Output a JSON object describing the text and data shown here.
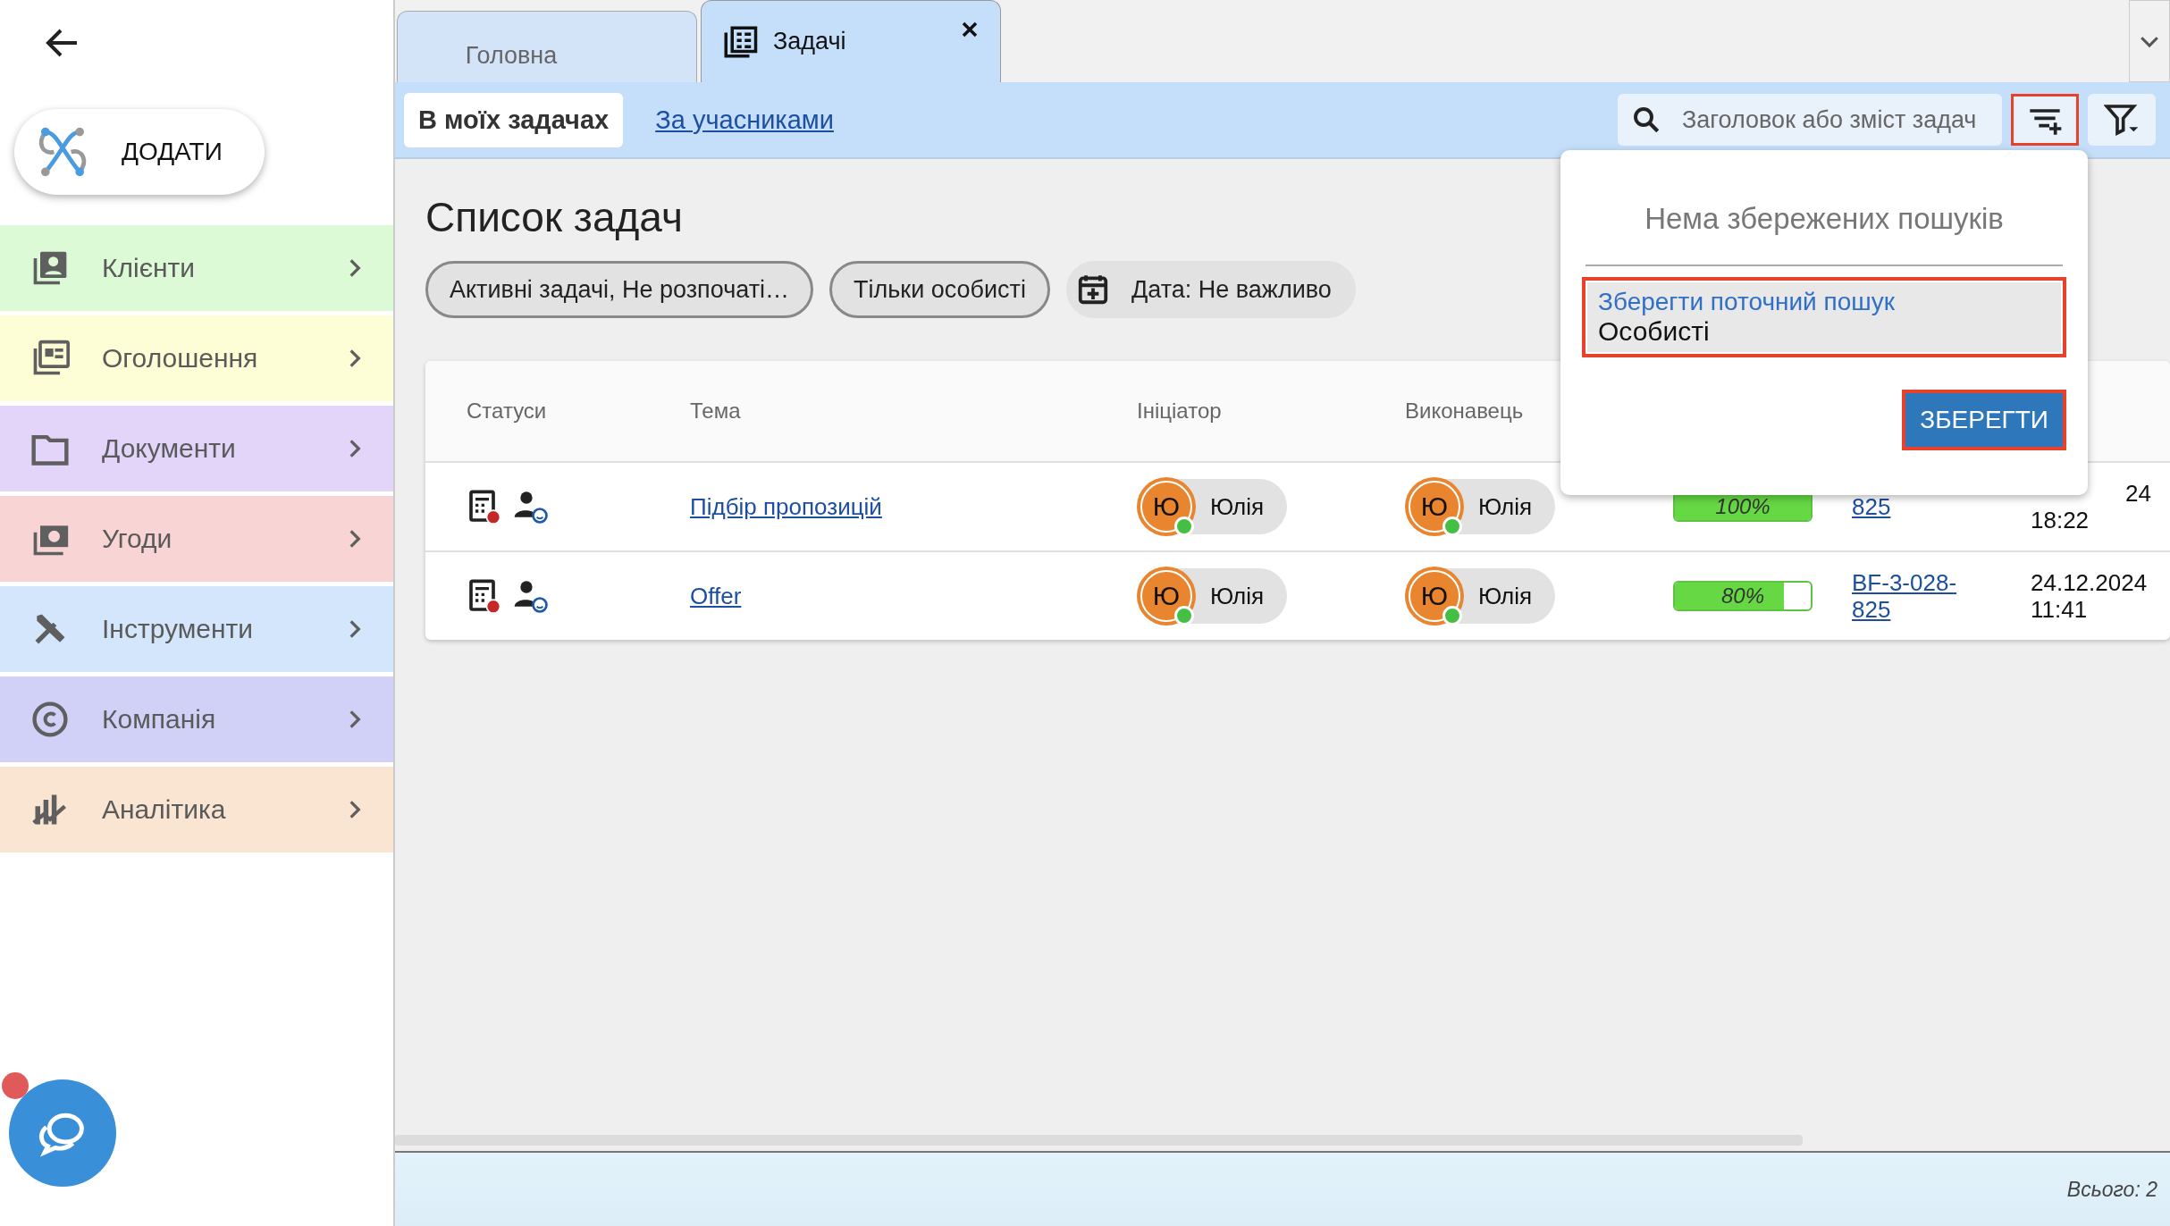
{
  "add_button": {
    "label": "ДОДАТИ"
  },
  "menu": [
    {
      "label": "Клієнти",
      "color": "#dcfad6",
      "kind": "contacts"
    },
    {
      "label": "Оголошення",
      "color": "#fdfdd6",
      "kind": "news"
    },
    {
      "label": "Документи",
      "color": "#e3d5fa",
      "kind": "folder"
    },
    {
      "label": "Угоди",
      "color": "#f8d4d4",
      "kind": "money"
    },
    {
      "label": "Інструменти",
      "color": "#d4e6fb",
      "kind": "tools"
    },
    {
      "label": "Компанія",
      "color": "#d1d1f7",
      "kind": "copyright"
    },
    {
      "label": "Аналітика",
      "color": "#fae5d2",
      "kind": "chart"
    }
  ],
  "tabs": [
    {
      "label": "Головна",
      "selected": false,
      "closable": false
    },
    {
      "label": "Задачі",
      "selected": true,
      "closable": true
    }
  ],
  "view_tabs": [
    {
      "label": "В моїх задачах",
      "selected": true
    },
    {
      "label": "За учасниками",
      "selected": false
    }
  ],
  "search": {
    "placeholder": "Заголовок або зміст задач"
  },
  "save_search_button": {
    "highlighted": true
  },
  "page_title": "Список задач",
  "chips": [
    {
      "label": "Активні задачі, Не розпочаті…",
      "kind": "filter"
    },
    {
      "label": "Тільки особисті",
      "kind": "filter"
    },
    {
      "label": "Дата: Не важливо",
      "kind": "date"
    }
  ],
  "table": {
    "columns": [
      "Статуси",
      "Тема",
      "Ініціатор",
      "Виконавець"
    ],
    "rows": [
      {
        "topic": "Підбір пропозицій",
        "initiator": {
          "initial": "Ю",
          "name": "Юлія",
          "online": true
        },
        "assignee": {
          "initial": "Ю",
          "name": "Юлія",
          "online": true
        },
        "progress": {
          "level": 1,
          "label": "100%"
        },
        "ref": [
          "825"
        ],
        "date": [
          "24",
          "18:22"
        ],
        "date_clipped": true
      },
      {
        "topic": "Offer",
        "initiator": {
          "initial": "Ю",
          "name": "Юлія",
          "online": true
        },
        "assignee": {
          "initial": "Ю",
          "name": "Юлія",
          "online": true
        },
        "progress": {
          "level": 0.8,
          "label": "80%"
        },
        "ref": [
          "BF-3-028-",
          "825"
        ],
        "date": [
          "24.12.2024",
          "11:41"
        ],
        "date_clipped": false
      }
    ]
  },
  "popup": {
    "empty_text": "Нема збережених пошуків",
    "field": {
      "label": "Зберегти поточний пошук",
      "value": "Особисті",
      "highlighted": true
    },
    "save_button": {
      "label": "ЗБЕРЕГТИ",
      "highlighted": true
    }
  },
  "footer": {
    "total": "Всього: 2"
  }
}
